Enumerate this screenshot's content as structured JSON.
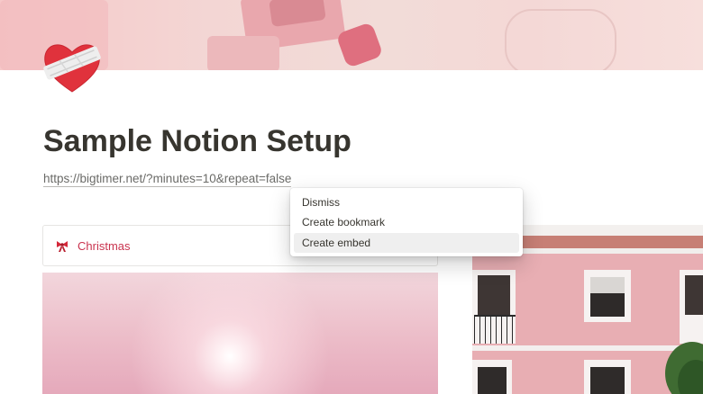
{
  "page": {
    "title": "Sample Notion Setup",
    "url": "https://bigtimer.net/?minutes=10&repeat=false",
    "icon": "heart-bandage-icon"
  },
  "context_menu": {
    "items": [
      {
        "label": "Dismiss"
      },
      {
        "label": "Create bookmark"
      },
      {
        "label": "Create embed"
      }
    ],
    "hovered_index": 2
  },
  "gallery": {
    "card_icon": "ribbon-bow-icon",
    "card_label": "Christmas"
  },
  "colors": {
    "title_text": "#37352f",
    "card_label": "#c9344f",
    "heart_red": "#e0323c",
    "menu_hover": "#efefef"
  }
}
